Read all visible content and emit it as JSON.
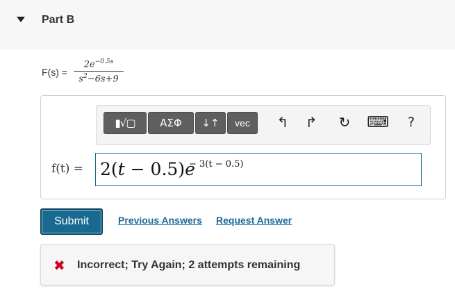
{
  "header": {
    "title": "Part B"
  },
  "problem": {
    "lhs": "F(s) =",
    "num_base": "2e",
    "num_exp": "−0.5s",
    "den_s": "s",
    "den_s_exp": "2",
    "den_rest": "−6s+9"
  },
  "toolbar": {
    "templates_label": "▮√▢",
    "greek_label": "ΑΣΦ",
    "arrows_label": "↓↑",
    "vec_label": "vec",
    "undo": "↰",
    "redo": "↱",
    "reset": "↻",
    "keyboard": "⌨",
    "help": "?"
  },
  "answer": {
    "label": "f(t) =",
    "coef": "2",
    "open": "(",
    "var": "t",
    "minus_const": " − 0.5)",
    "e": "e",
    "exponent": "− 3(t − 0.5)"
  },
  "actions": {
    "submit": "Submit",
    "previous_answers": "Previous Answers",
    "request_answer": "Request Answer"
  },
  "feedback": {
    "icon": "✖",
    "message": "Incorrect; Try Again; 2 attempts remaining",
    "status_color": "#d0021b"
  }
}
